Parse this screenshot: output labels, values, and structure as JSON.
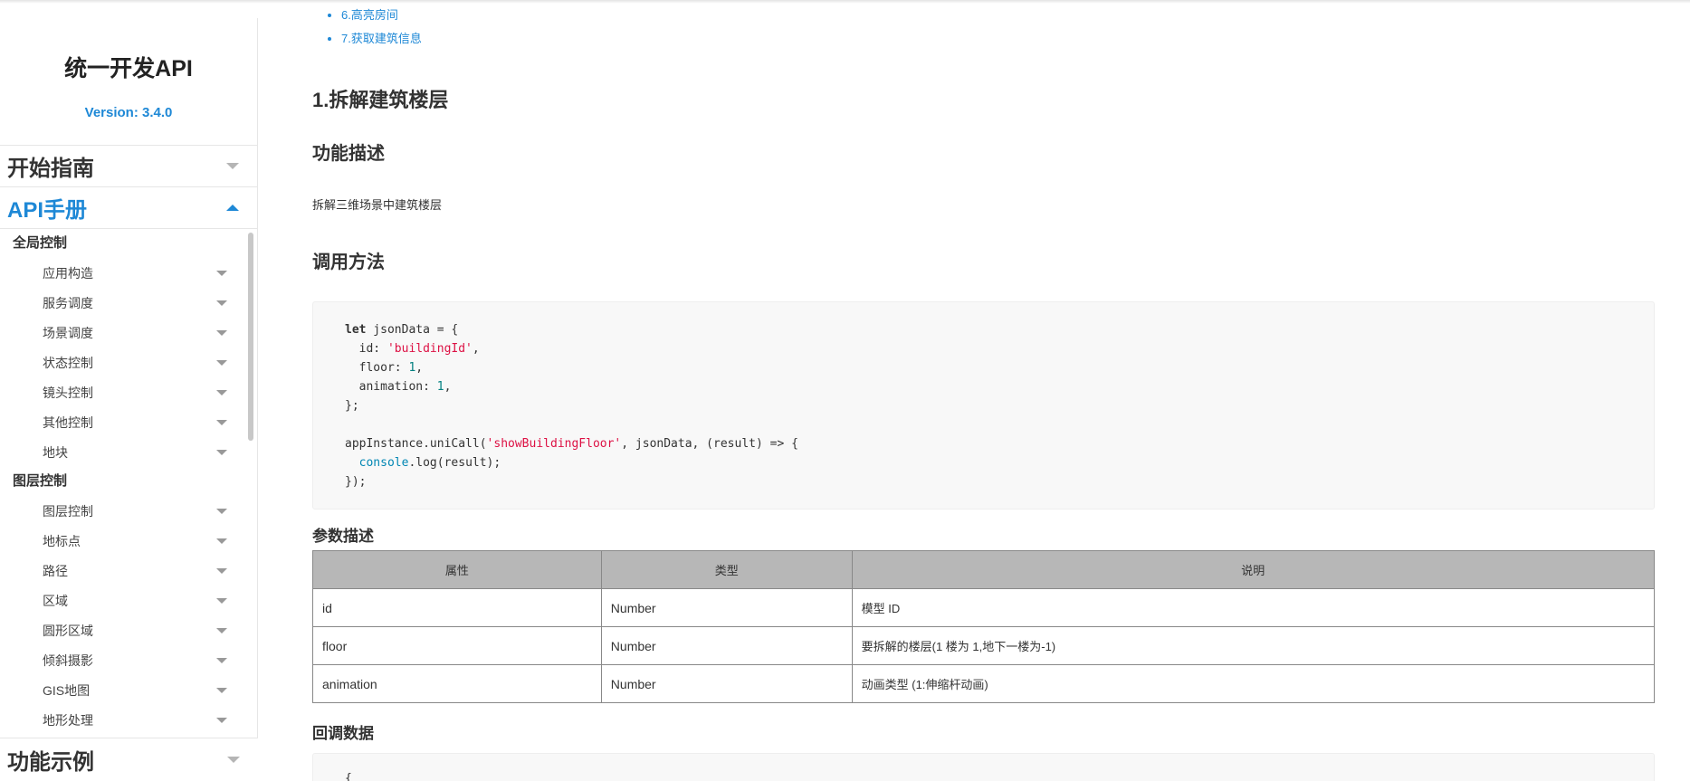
{
  "sidebar": {
    "title": "统一开发API",
    "version": "Version: 3.4.0",
    "sections": {
      "start": "开始指南",
      "api": "API手册",
      "examples": "功能示例"
    },
    "groups": [
      {
        "title": "全局控制",
        "items": [
          "应用构造",
          "服务调度",
          "场景调度",
          "状态控制",
          "镜头控制",
          "其他控制",
          "地块"
        ]
      },
      {
        "title": "图层控制",
        "items": [
          "图层控制",
          "地标点",
          "路径",
          "区域",
          "圆形区域",
          "倾斜摄影",
          "GIS地图",
          "地形处理"
        ]
      }
    ]
  },
  "main": {
    "toc": [
      "6.高亮房间",
      "7.获取建筑信息"
    ],
    "section_title": "1.拆解建筑楼层",
    "func_desc_title": "功能描述",
    "func_desc_text": "拆解三维场景中建筑楼层",
    "call_title": "调用方法",
    "code": {
      "l1_kw": "let",
      "l1_rest": " jsonData = {",
      "l2_key": "  id: ",
      "l2_val": "'buildingId'",
      "l2_end": ",",
      "l3_key": "  floor: ",
      "l3_val": "1",
      "l3_end": ",",
      "l4_key": "  animation: ",
      "l4_val": "1",
      "l4_end": ",",
      "l5": "};",
      "l7_pre": "appInstance.uniCall(",
      "l7_str": "'showBuildingFloor'",
      "l7_post": ", jsonData, (result) => {",
      "l8_pre": "  ",
      "l8_fn": "console",
      "l8_post": ".log(result);",
      "l9": "});"
    },
    "params_title": "参数描述",
    "params_table": {
      "headers": [
        "属性",
        "类型",
        "说明"
      ],
      "rows": [
        [
          "id",
          "Number",
          "模型 ID"
        ],
        [
          "floor",
          "Number",
          "要拆解的楼层(1 楼为 1,地下一楼为-1)"
        ],
        [
          "animation",
          "Number",
          "动画类型 (1:伸缩杆动画)"
        ]
      ]
    },
    "callback_title": "回调数据",
    "callback_code_first": "{"
  },
  "colors": {
    "accent": "#1e88d6",
    "table_header": "#b7b7b7",
    "code_bg": "#f8f8f8",
    "string": "#dd1144",
    "number": "#008080"
  }
}
